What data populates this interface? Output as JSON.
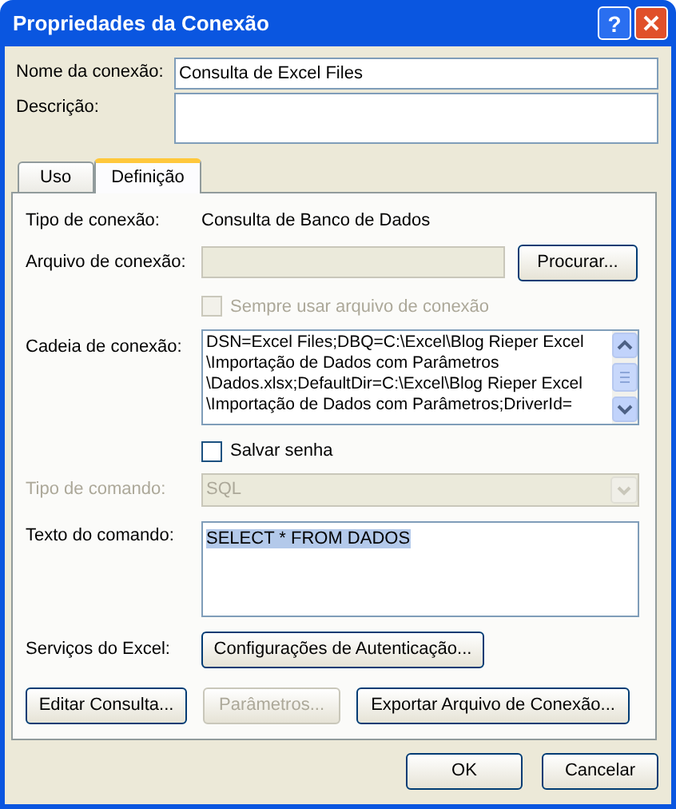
{
  "window": {
    "title": "Propriedades da Conexão",
    "help": "?"
  },
  "connection_name": {
    "label": "Nome da conexão:",
    "value": "Consulta de Excel Files"
  },
  "description": {
    "label": "Descrição:"
  },
  "tabs": [
    {
      "label": "Uso",
      "selected": false
    },
    {
      "label": "Definição",
      "selected": true
    }
  ],
  "definition": {
    "connection_type": {
      "label": "Tipo de conexão:",
      "value": "Consulta de Banco de Dados"
    },
    "connection_file": {
      "label": "Arquivo de conexão:",
      "disabled": true,
      "button": "Procurar..."
    },
    "always_use_file": {
      "label": "Sempre usar arquivo de conexão",
      "checked": false,
      "disabled": true
    },
    "connection_string": {
      "label": "Cadeia de conexão:",
      "lines": [
        "DSN=Excel Files;DBQ=C:\\Excel\\Blog Rieper Excel",
        "\\Importação de Dados com Parâmetros",
        "\\Dados.xlsx;DefaultDir=C:\\Excel\\Blog Rieper Excel",
        "\\Importação de Dados com Parâmetros;DriverId="
      ]
    },
    "save_password": {
      "label": "Salvar senha",
      "checked": false,
      "disabled": false
    },
    "command_type": {
      "label": "Tipo de comando:",
      "value": "SQL",
      "disabled": true
    },
    "command_text": {
      "label": "Texto do comando:",
      "value": "SELECT * FROM DADOS",
      "selected": true
    },
    "excel_services": {
      "label": "Serviços do Excel:",
      "button": "Configurações de Autenticação..."
    },
    "actions": [
      {
        "label": "Editar Consulta...",
        "disabled": false
      },
      {
        "label": "Parâmetros...",
        "disabled": true
      },
      {
        "label": "Exportar Arquivo de Conexão...",
        "disabled": false
      }
    ]
  },
  "footer_buttons": [
    "OK",
    "Cancelar"
  ]
}
